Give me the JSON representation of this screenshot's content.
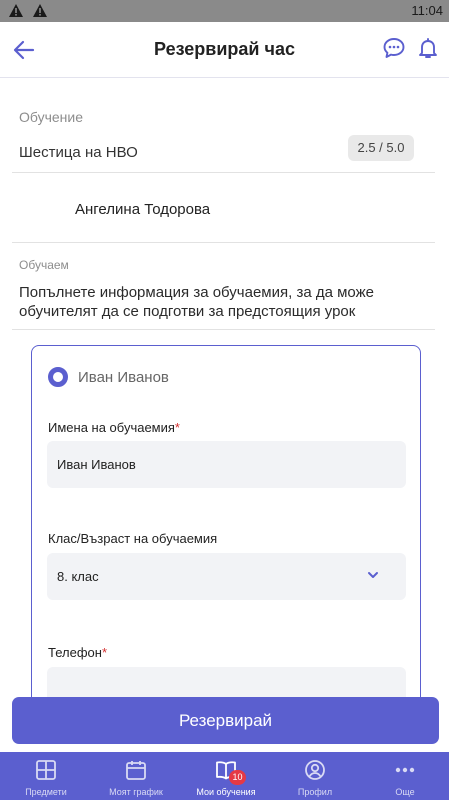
{
  "status_bar": {
    "time": "11:04"
  },
  "header": {
    "title": "Резервирай час"
  },
  "training": {
    "label": "Обучение",
    "name": "Шестица на НВО",
    "rating": "2.5 / 5.0",
    "teacher": "Ангелина Тодорова"
  },
  "learner": {
    "label": "Обучаем",
    "description": "Попълнете информация за обучаемия, за да може обучителят да се подготви за предстоящия урок"
  },
  "form": {
    "selected_learner": "Иван Иванов",
    "name_label": "Имена на обучаемия",
    "name_value": "Иван Иванов",
    "grade_label": "Клас/Възраст на обучаемия",
    "grade_value": "8. клас",
    "phone_label": "Телефон",
    "required_mark": "*"
  },
  "actions": {
    "reserve_label": "Резервирай"
  },
  "bottom_nav": {
    "items": [
      {
        "label": "Предмети",
        "icon": "grid-icon"
      },
      {
        "label": "Моят график",
        "icon": "calendar-icon"
      },
      {
        "label": "Мои обучения",
        "icon": "book-icon",
        "badge": "10"
      },
      {
        "label": "Профил",
        "icon": "profile-icon"
      },
      {
        "label": "Още",
        "icon": "more-icon"
      }
    ]
  },
  "colors": {
    "accent": "#5b5fcf",
    "badge": "#e53945",
    "required": "#d32f2f"
  }
}
